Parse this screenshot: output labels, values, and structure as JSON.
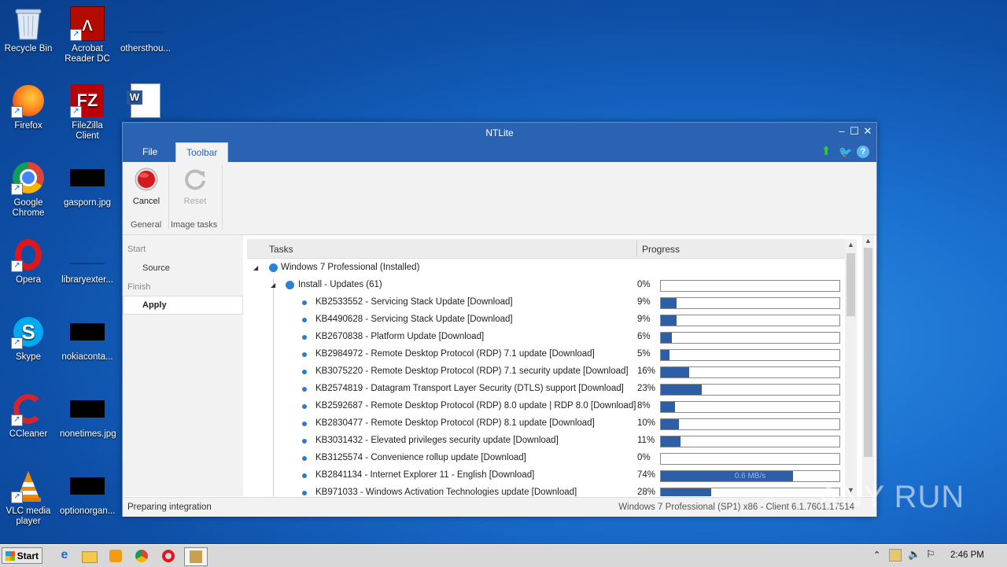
{
  "desktop": {
    "icons": [
      {
        "label": "Recycle Bin"
      },
      {
        "label": "Acrobat Reader DC"
      },
      {
        "label": "othersthou..."
      },
      {
        "label": "Firefox"
      },
      {
        "label": "FileZilla Client"
      },
      {
        "label": "Google Chrome"
      },
      {
        "label": "gasporn.jpg"
      },
      {
        "label": "Opera"
      },
      {
        "label": "libraryexter..."
      },
      {
        "label": "Skype"
      },
      {
        "label": "nokiaconta..."
      },
      {
        "label": "CCleaner"
      },
      {
        "label": "nonetimes.jpg"
      },
      {
        "label": "VLC media player"
      },
      {
        "label": "optionorgan..."
      }
    ]
  },
  "window": {
    "title": "NTLite",
    "menu": {
      "file": "File",
      "toolbar": "Toolbar"
    },
    "ribbon": {
      "cancel": "Cancel",
      "reset": "Reset",
      "group_general": "General",
      "group_image_tasks": "Image tasks"
    },
    "sidebar": {
      "start": "Start",
      "source": "Source",
      "finish": "Finish",
      "apply": "Apply"
    },
    "table": {
      "col_tasks": "Tasks",
      "col_progress": "Progress",
      "root": "Windows 7 Professional  (Installed)",
      "group": "Install - Updates (61)",
      "group_pct": "0%",
      "group_progress": 0,
      "rows": [
        {
          "label": "KB2533552 - Servicing Stack Update [Download]",
          "pct": "9%",
          "progress": 9
        },
        {
          "label": "KB4490628 - Servicing Stack Update [Download]",
          "pct": "9%",
          "progress": 9
        },
        {
          "label": "KB2670838 - Platform Update [Download]",
          "pct": "6%",
          "progress": 6
        },
        {
          "label": "KB2984972 - Remote Desktop Protocol (RDP) 7.1 update [Download]",
          "pct": "5%",
          "progress": 5
        },
        {
          "label": "KB3075220 - Remote Desktop Protocol (RDP) 7.1 security update [Download]",
          "pct": "16%",
          "progress": 16
        },
        {
          "label": "KB2574819 - Datagram Transport Layer Security (DTLS) support [Download]",
          "pct": "23%",
          "progress": 23
        },
        {
          "label": "KB2592687 - Remote Desktop Protocol (RDP) 8.0 update | RDP 8.0 [Download]",
          "pct": "8%",
          "progress": 8
        },
        {
          "label": "KB2830477 - Remote Desktop Protocol (RDP) 8.1 update [Download]",
          "pct": "10%",
          "progress": 10
        },
        {
          "label": "KB3031432 - Elevated privileges security update [Download]",
          "pct": "11%",
          "progress": 11
        },
        {
          "label": "KB3125574 - Convenience rollup update [Download]",
          "pct": "0%",
          "progress": 0
        },
        {
          "label": "KB2841134 - Internet Explorer 11 - English [Download]",
          "pct": "74%",
          "progress": 74,
          "bar_text": "0.6 MB/s"
        },
        {
          "label": "KB971033 - Windows Activation Technologies update [Download]",
          "pct": "28%",
          "progress": 28
        }
      ]
    },
    "status": {
      "left": "Preparing integration",
      "right": "Windows 7 Professional (SP1) x86 - Client 6.1.7601.17514"
    }
  },
  "taskbar": {
    "start": "Start",
    "clock": "2:46 PM"
  },
  "watermark": "ANY RUN"
}
